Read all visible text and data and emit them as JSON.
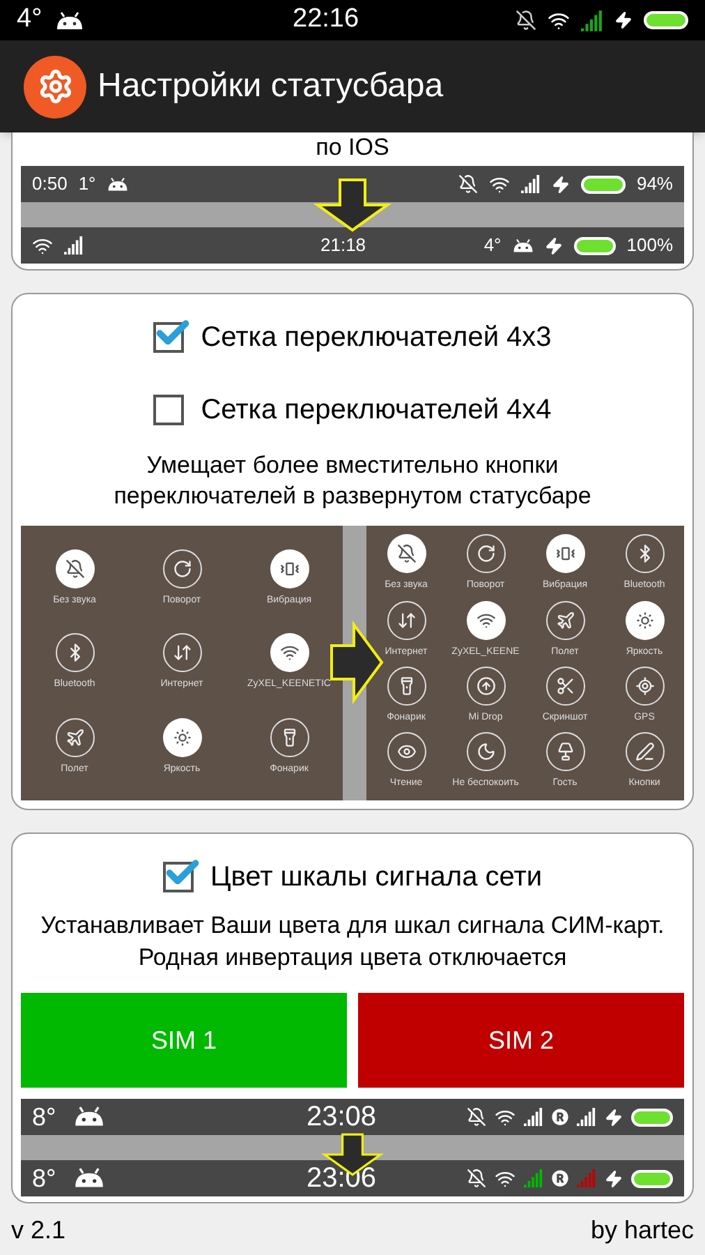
{
  "status_bar": {
    "temperature": "4°",
    "time": "22:16"
  },
  "app_bar": {
    "title": "Настройки статусбара"
  },
  "ios_section": {
    "caption": "по IOS",
    "before": {
      "clock": "0:50",
      "temperature": "1°",
      "battery_text": "94%"
    },
    "after": {
      "time": "21:18",
      "temperature": "4°",
      "battery_text": "100%"
    }
  },
  "grid_section": {
    "options": [
      {
        "label": "Сетка переключателей 4x3",
        "checked": true
      },
      {
        "label": "Сетка переключателей 4x4",
        "checked": false
      }
    ],
    "description": "Умещает более вместительно кнопки переключателей в развернутом статусбаре",
    "before_tiles": [
      {
        "kind": "silent",
        "label": "Без звука",
        "active": true
      },
      {
        "kind": "rotate",
        "label": "Поворот",
        "active": false
      },
      {
        "kind": "vibrate",
        "label": "Вибрация",
        "active": true
      },
      {
        "kind": "bluetooth",
        "label": "Bluetooth",
        "active": false
      },
      {
        "kind": "data",
        "label": "Интернет",
        "active": false
      },
      {
        "kind": "wifi",
        "label": "ZyXEL_KEENETIC",
        "active": true
      },
      {
        "kind": "airplane",
        "label": "Полет",
        "active": false
      },
      {
        "kind": "brightness",
        "label": "Яркость",
        "active": true
      },
      {
        "kind": "torch",
        "label": "Фонарик",
        "active": false
      }
    ],
    "after_tiles": [
      {
        "kind": "silent",
        "label": "Без звука",
        "active": true
      },
      {
        "kind": "rotate",
        "label": "Поворот",
        "active": false
      },
      {
        "kind": "vibrate",
        "label": "Вибрация",
        "active": true
      },
      {
        "kind": "bluetooth",
        "label": "Bluetooth",
        "active": false
      },
      {
        "kind": "data",
        "label": "Интернет",
        "active": false
      },
      {
        "kind": "wifi",
        "label": "ZyXEL_KEENE",
        "active": true
      },
      {
        "kind": "airplane",
        "label": "Полет",
        "active": false
      },
      {
        "kind": "brightness",
        "label": "Яркость",
        "active": true
      },
      {
        "kind": "torch",
        "label": "Фонарик",
        "active": false
      },
      {
        "kind": "share",
        "label": "Mi Drop",
        "active": false
      },
      {
        "kind": "screenshot",
        "label": "Скриншот",
        "active": false
      },
      {
        "kind": "gps",
        "label": "GPS",
        "active": false
      },
      {
        "kind": "reading",
        "label": "Чтение",
        "active": false
      },
      {
        "kind": "dnd",
        "label": "Не беспокоить",
        "active": false
      },
      {
        "kind": "guest",
        "label": "Гость",
        "active": false
      },
      {
        "kind": "buttons",
        "label": "Кнопки",
        "active": false
      }
    ]
  },
  "signal_section": {
    "option": {
      "label": "Цвет шкалы сигнала сети",
      "checked": true
    },
    "description": "Устанавливает Ваши цвета для шкал сигнала СИМ-карт. Родная инвертация цвета отключается",
    "sims": [
      {
        "label": "SIM 1",
        "color": "#00b900"
      },
      {
        "label": "SIM 2",
        "color": "#c00000"
      }
    ],
    "before": {
      "temperature": "8°",
      "time": "23:08",
      "colored_signal": false
    },
    "after": {
      "temperature": "8°",
      "time": "23:06",
      "colored_signal": true
    }
  },
  "footer": {
    "version": "v 2.1",
    "author": "by hartec"
  }
}
